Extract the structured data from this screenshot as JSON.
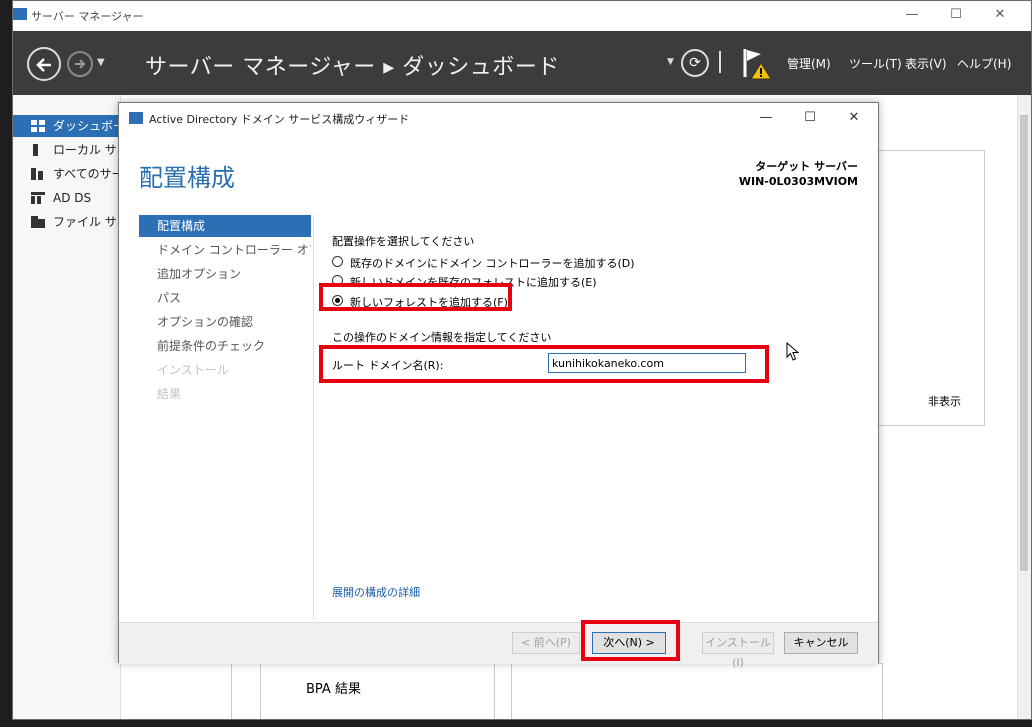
{
  "outer_window": {
    "title": "サーバー マネージャー",
    "controls": {
      "minimize": "—",
      "maximize": "☐",
      "close": "✕"
    }
  },
  "header": {
    "breadcrumb": "サーバー マネージャー ▸ ダッシュボード",
    "menu": [
      "管理(M)",
      "ツール(T)",
      "表示(V)",
      "ヘルプ(H)"
    ]
  },
  "sidebar": {
    "items": [
      {
        "label": "ダッシュボード",
        "icon": "dashboard-icon"
      },
      {
        "label": "ローカル サーバー",
        "icon": "local-server-icon"
      },
      {
        "label": "すべてのサーバー",
        "icon": "all-servers-icon"
      },
      {
        "label": "AD DS",
        "icon": "ad-ds-icon"
      },
      {
        "label": "ファイル サービス",
        "icon": "file-services-icon"
      }
    ]
  },
  "background": {
    "hide_label": "非表示",
    "bpa_label": "BPA 結果"
  },
  "wizard": {
    "title": "Active Directory ドメイン サービス構成ウィザード",
    "heading": "配置構成",
    "target_label": "ターゲット サーバー",
    "target_name": "WIN-0L0303MVIOM",
    "steps": [
      {
        "label": "配置構成",
        "state": "active"
      },
      {
        "label": "ドメイン コントローラー オプション",
        "state": "normal"
      },
      {
        "label": "追加オプション",
        "state": "normal"
      },
      {
        "label": "パス",
        "state": "normal"
      },
      {
        "label": "オプションの確認",
        "state": "normal"
      },
      {
        "label": "前提条件のチェック",
        "state": "normal"
      },
      {
        "label": "インストール",
        "state": "disabled"
      },
      {
        "label": "結果",
        "state": "disabled"
      }
    ],
    "select_operation_label": "配置操作を選択してください",
    "options": [
      {
        "label": "既存のドメインにドメイン コントローラーを追加する(D)",
        "checked": false
      },
      {
        "label": "新しいドメインを既存のフォレストに追加する(E)",
        "checked": false
      },
      {
        "label": "新しいフォレストを追加する(F)",
        "checked": true
      }
    ],
    "domain_info_label": "この操作のドメイン情報を指定してください",
    "root_domain_label": "ルート ドメイン名(R):",
    "root_domain_value": "kunihikokaneko.com",
    "details_link": "展開の構成の詳細",
    "buttons": {
      "back": "< 前へ(P)",
      "next": "次へ(N) >",
      "install": "インストール(I)",
      "cancel": "キャンセル"
    }
  },
  "colors": {
    "accent": "#2b6fb5",
    "header_bg": "#3c3c3c",
    "annotation": "#e60012",
    "heading": "#2a6fb0"
  }
}
